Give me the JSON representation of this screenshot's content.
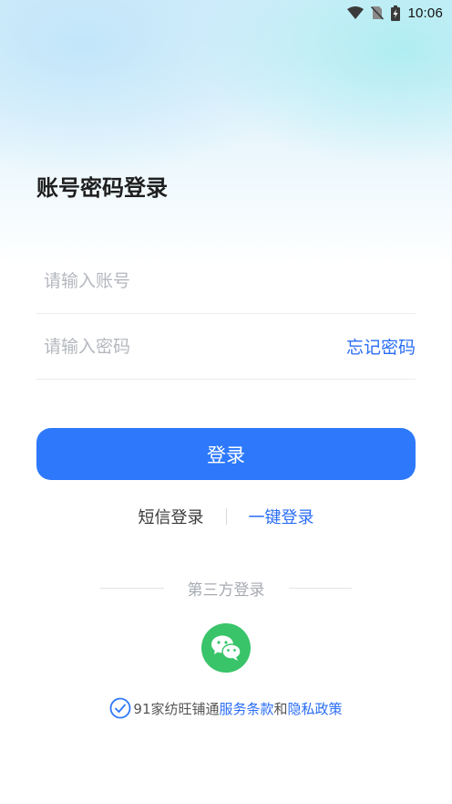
{
  "status_bar": {
    "time": "10:06"
  },
  "title": "账号密码登录",
  "account": {
    "placeholder": "请输入账号",
    "value": ""
  },
  "password": {
    "placeholder": "请输入密码",
    "value": ""
  },
  "forgot_label": "忘记密码",
  "login_label": "登录",
  "alt_login": {
    "sms_label": "短信登录",
    "onekey_label": "一键登录"
  },
  "third_party_label": "第三方登录",
  "wechat_icon": "wechat-icon",
  "agreement": {
    "prefix": "91家纺旺铺通",
    "terms_label": "服务条款",
    "conjunction": "和",
    "privacy_label": "隐私政策",
    "checked": true
  },
  "colors": {
    "accent": "#2e79fb",
    "link": "#2a6df4",
    "wechat": "#3ac46a",
    "title": "#1f1f1f",
    "placeholder": "#b4b8be"
  }
}
